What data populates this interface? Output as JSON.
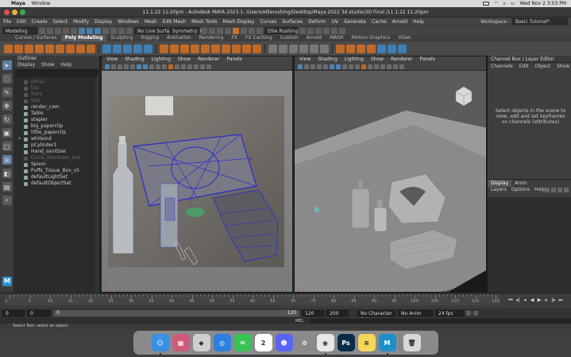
{
  "mac_menubar": {
    "app": "Maya",
    "items": [
      "Window"
    ],
    "clock": "Wed Nov 2  3:03 PM"
  },
  "titlebar": {
    "title": "11.1.22 11:20pm - Autodesk MAYA 2023.1: /Users/ellierushing/Desktop/Maya 2022 3d studio/3D Final /11.1.22 11:20pm"
  },
  "main_menu": {
    "items": [
      "File",
      "Edit",
      "Create",
      "Select",
      "Modify",
      "Display",
      "Windows",
      "Mesh",
      "Edit Mesh",
      "Mesh Tools",
      "Mesh Display",
      "Curves",
      "Surfaces",
      "Deform",
      "UV",
      "Generate",
      "Cache",
      "Arnold",
      "Help"
    ],
    "workspace_label": "Workspace :",
    "workspace_value": "Basic Tutorial*"
  },
  "status_line": {
    "mode": "Modeling",
    "live_surface": "No Live Surface",
    "symmetry": "Symmetry: Off",
    "user": "Ellie Rushing"
  },
  "shelf": {
    "tabs": [
      "Curves / Surfaces",
      "Poly Modeling",
      "Sculpting",
      "Rigging",
      "Animation",
      "Rendering",
      "FX",
      "FX Caching",
      "Custom",
      "Arnold",
      "MASH",
      "Motion Graphics",
      "XGen"
    ],
    "active_tab": "Poly Modeling"
  },
  "outliner": {
    "title": "Outliner",
    "menu": [
      "Display",
      "Show",
      "Help"
    ],
    "items": [
      {
        "label": "persp",
        "dim": true
      },
      {
        "label": "top",
        "dim": true
      },
      {
        "label": "front",
        "dim": true
      },
      {
        "label": "side",
        "dim": true
      },
      {
        "label": "render_cam",
        "dim": false
      },
      {
        "label": "Table",
        "dim": false
      },
      {
        "label": "stapler",
        "dim": false
      },
      {
        "label": "big_paperclip",
        "dim": false
      },
      {
        "label": "little_paperclip",
        "dim": false
      },
      {
        "label": "whiteout",
        "dim": false,
        "expand": true
      },
      {
        "label": "pCylinder1",
        "dim": false
      },
      {
        "label": "Hand_sanitizer",
        "dim": false
      },
      {
        "label": "Quick_Reminder_box",
        "dim": true
      },
      {
        "label": "Spoon",
        "dim": false
      },
      {
        "label": "Puffs_Tissue_Box_v5",
        "dim": false
      },
      {
        "label": "defaultLightSet",
        "dim": false
      },
      {
        "label": "defaultObjectSet",
        "dim": false
      }
    ]
  },
  "viewport_menu": [
    "View",
    "Shading",
    "Lighting",
    "Show",
    "Renderer",
    "Panels"
  ],
  "channel_box": {
    "title": "Channel Box / Layer Editor",
    "menu": [
      "Channels",
      "Edit",
      "Object",
      "Show"
    ],
    "message": "Select objects in the scene to view, edit and set keyframes on channels (attributes)"
  },
  "layer_editor": {
    "tabs": [
      "Display",
      "Anim"
    ],
    "active_tab": "Display",
    "menu": [
      "Layers",
      "Options",
      "Help"
    ]
  },
  "time_slider": {
    "ticks": [
      "5",
      "10",
      "15",
      "20",
      "25",
      "30",
      "35",
      "40",
      "45",
      "50",
      "55",
      "60",
      "65",
      "70",
      "75",
      "80",
      "85",
      "90",
      "95",
      "100",
      "105",
      "110",
      "115",
      "120"
    ],
    "current_frame": "1"
  },
  "range_slider": {
    "start": "0",
    "start2": "0",
    "range_start": "0",
    "range_end": "120",
    "end": "120",
    "end2": "200",
    "character_set": "No Character Set",
    "anim_layer": "No Anim Layer",
    "fps": "24 fps"
  },
  "command_line": {
    "label": "MEL"
  },
  "help_line": {
    "text": "Select Tool: select an object"
  },
  "dock": {
    "apps": [
      {
        "name": "Finder",
        "label": "☺",
        "color": "#3a8ee6"
      },
      {
        "name": "Launchpad",
        "label": "▦",
        "color": "#d05a7a"
      },
      {
        "name": "Roblox",
        "label": "◆",
        "color": "#cfcfcf"
      },
      {
        "name": "Safari",
        "label": "◎",
        "color": "#2d7fe0"
      },
      {
        "name": "Messages",
        "label": "✉",
        "color": "#37c454"
      },
      {
        "name": "Calendar",
        "label": "2",
        "color": "#ffffff"
      },
      {
        "name": "Discord",
        "label": "☻",
        "color": "#5865f2"
      },
      {
        "name": "System Settings",
        "label": "⚙",
        "color": "#8a8a8a"
      },
      {
        "name": "Chrome",
        "label": "◉",
        "color": "#e8e8e8"
      },
      {
        "name": "Photoshop",
        "label": "Ps",
        "color": "#0b2a4a"
      },
      {
        "name": "Notes",
        "label": "≡",
        "color": "#f4d65a"
      },
      {
        "name": "Maya",
        "label": "M",
        "color": "#1c8fc9"
      },
      {
        "name": "Trash",
        "label": "🗑",
        "color": "#d8d8d8"
      }
    ],
    "calendar_month": "NOV"
  },
  "colors": {
    "accent_orange": "#c4722f",
    "accent_blue": "#4b7ea9",
    "wireframe_blue": "#2a2ad0"
  }
}
